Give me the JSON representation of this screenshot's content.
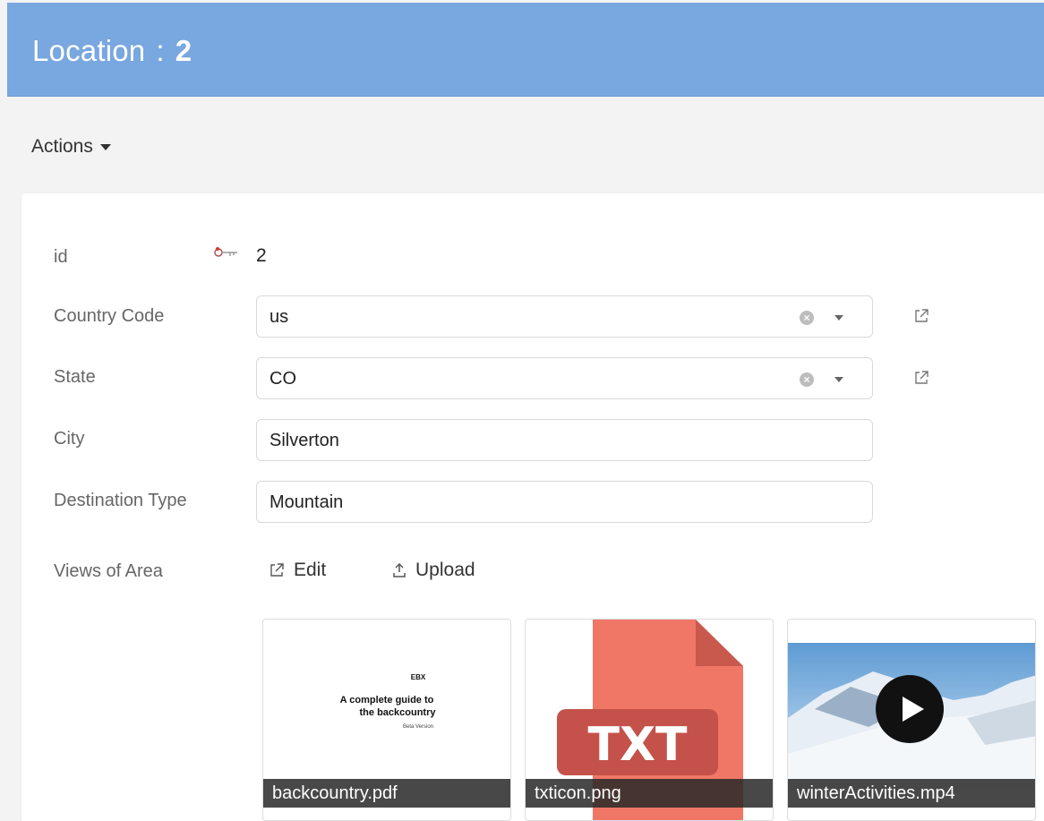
{
  "header": {
    "title": "Location",
    "separator": ":",
    "record_id": "2"
  },
  "actions": {
    "label": "Actions"
  },
  "form": {
    "id": {
      "label": "id",
      "value": "2"
    },
    "country_code": {
      "label": "Country Code",
      "value": "us"
    },
    "state": {
      "label": "State",
      "value": "CO"
    },
    "city": {
      "label": "City",
      "value": "Silverton"
    },
    "destination_type": {
      "label": "Destination Type",
      "value": "Mountain"
    },
    "views": {
      "label": "Views of Area",
      "edit_label": "Edit",
      "upload_label": "Upload"
    }
  },
  "attachments": [
    {
      "filename": "backcountry.pdf",
      "preview": {
        "brand": "EBX",
        "title_line1": "A complete guide to",
        "title_line2": "the backcountry",
        "subtitle": "Beta Version"
      }
    },
    {
      "filename": "txticon.png",
      "icon_text": "TXT"
    },
    {
      "filename": "winterActivities.mp4"
    }
  ],
  "colors": {
    "header_bg": "#79a7df",
    "txt_icon": "#f07766",
    "txt_icon_dark": "#c4524a"
  }
}
